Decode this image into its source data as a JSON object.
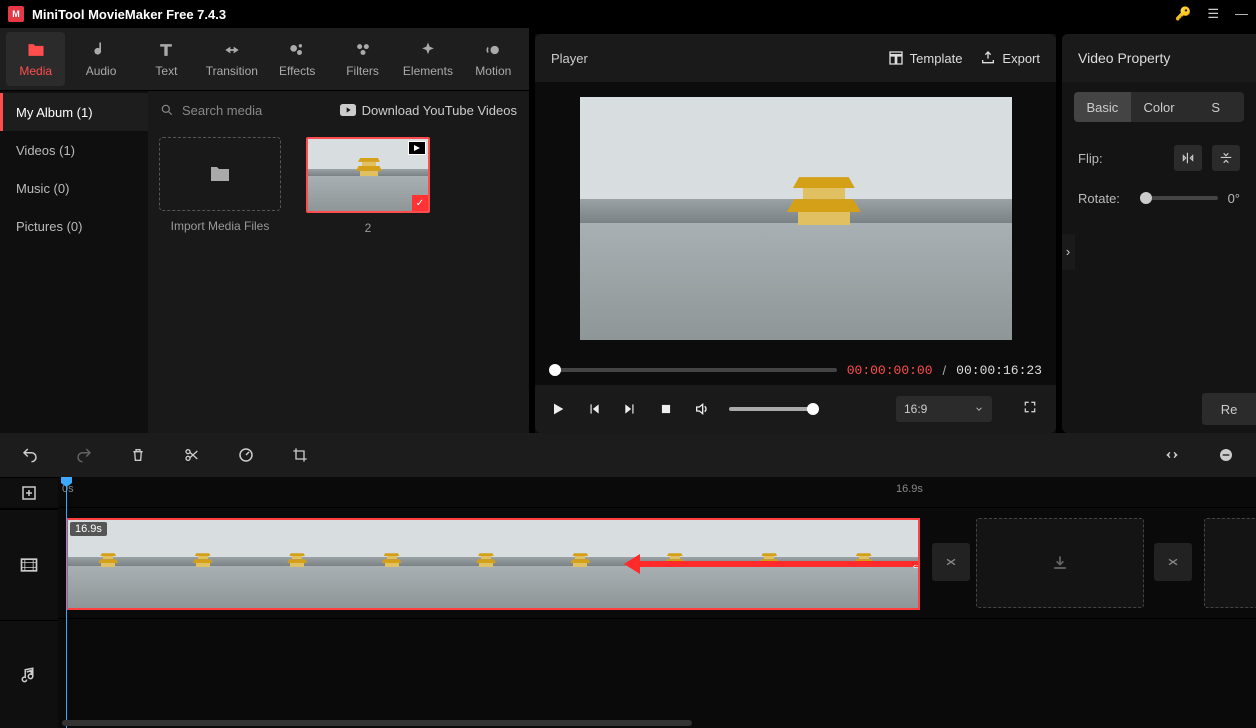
{
  "app": {
    "title": "MiniTool MovieMaker Free 7.4.3"
  },
  "mainTabs": [
    {
      "id": "media",
      "label": "Media"
    },
    {
      "id": "audio",
      "label": "Audio"
    },
    {
      "id": "text",
      "label": "Text"
    },
    {
      "id": "transition",
      "label": "Transition"
    },
    {
      "id": "effects",
      "label": "Effects"
    },
    {
      "id": "filters",
      "label": "Filters"
    },
    {
      "id": "elements",
      "label": "Elements"
    },
    {
      "id": "motion",
      "label": "Motion"
    }
  ],
  "sideCats": [
    {
      "id": "myalbum",
      "label": "My Album (1)"
    },
    {
      "id": "videos",
      "label": "Videos (1)"
    },
    {
      "id": "music",
      "label": "Music (0)"
    },
    {
      "id": "pictures",
      "label": "Pictures (0)"
    }
  ],
  "mediaTop": {
    "searchPlaceholder": "Search media",
    "youtubeLink": "Download YouTube Videos"
  },
  "mediaItems": {
    "importLabel": "Import Media Files",
    "clip1Name": "2"
  },
  "player": {
    "title": "Player",
    "templateBtn": "Template",
    "exportBtn": "Export",
    "currentTime": "00:00:00:00",
    "totalTime": "00:00:16:23",
    "ratio": "16:9"
  },
  "props": {
    "title": "Video Property",
    "tabs": {
      "basic": "Basic",
      "color": "Color",
      "s": "S"
    },
    "flipLabel": "Flip:",
    "rotateLabel": "Rotate:",
    "rotateValue": "0°",
    "resetBtn": "Re"
  },
  "timeline": {
    "ruler": {
      "start": "0s",
      "end": "16.9s"
    },
    "clipDuration": "16.9s"
  }
}
